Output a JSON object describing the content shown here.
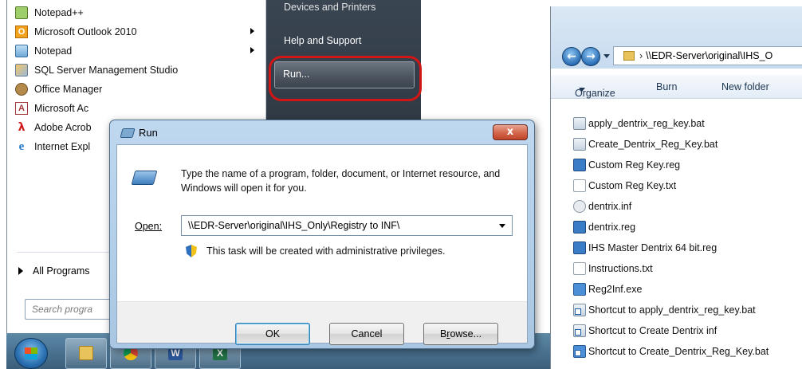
{
  "start_menu": {
    "programs": [
      {
        "label": "Notepad++",
        "icon": "notepad-plus-plus-icon",
        "has_submenu": false
      },
      {
        "label": "Microsoft Outlook 2010",
        "icon": "outlook-icon",
        "has_submenu": true
      },
      {
        "label": "Notepad",
        "icon": "notepad-icon",
        "has_submenu": true
      },
      {
        "label": "SQL Server Management Studio",
        "icon": "sql-server-icon",
        "has_submenu": false
      },
      {
        "label": "Office Manager",
        "icon": "office-manager-icon",
        "has_submenu": false
      },
      {
        "label": "Microsoft Ac",
        "icon": "access-icon",
        "has_submenu": false
      },
      {
        "label": "Adobe Acrob",
        "icon": "acrobat-icon",
        "has_submenu": false
      },
      {
        "label": "Internet Expl",
        "icon": "internet-explorer-icon",
        "has_submenu": false
      }
    ],
    "all_programs": "All Programs",
    "search_placeholder": "Search progra",
    "right_links": {
      "devices": "Devices and Printers",
      "help": "Help and Support",
      "run": "Run..."
    }
  },
  "run_dialog": {
    "title": "Run",
    "close_label": "x",
    "description": "Type the name of a program, folder, document, or Internet resource, and Windows will open it for you.",
    "open_label": "Open:",
    "open_value": "\\\\EDR-Server\\original\\IHS_Only\\Registry to INF\\",
    "admin_note": "This task will be created with administrative privileges.",
    "buttons": {
      "ok": "OK",
      "cancel": "Cancel",
      "browse_prefix": "B",
      "browse_accel": "r",
      "browse_suffix": "owse..."
    }
  },
  "explorer": {
    "address": "\\\\EDR-Server\\original\\IHS_O",
    "toolbar": {
      "organize": "Organize",
      "burn": "Burn",
      "new_folder": "New folder"
    },
    "files": [
      {
        "name": "apply_dentrix_reg_key.bat",
        "type": "bat"
      },
      {
        "name": "Create_Dentrix_Reg_Key.bat",
        "type": "bat"
      },
      {
        "name": "Custom Reg Key.reg",
        "type": "reg"
      },
      {
        "name": "Custom Reg Key.txt",
        "type": "txt"
      },
      {
        "name": "dentrix.inf",
        "type": "inf"
      },
      {
        "name": "dentrix.reg",
        "type": "reg"
      },
      {
        "name": "IHS Master Dentrix 64 bit.reg",
        "type": "reg"
      },
      {
        "name": "Instructions.txt",
        "type": "txt"
      },
      {
        "name": "Reg2Inf.exe",
        "type": "exe"
      },
      {
        "name": "Shortcut to apply_dentrix_reg_key.bat",
        "type": "lnk"
      },
      {
        "name": "Shortcut to Create Dentrix inf",
        "type": "lnk"
      },
      {
        "name": "Shortcut to Create_Dentrix_Reg_Key.bat",
        "type": "lnk"
      }
    ]
  },
  "taskbar": {
    "buttons": [
      {
        "name": "explorer-taskbar-button",
        "glyph": "",
        "color": "#e8c25a"
      },
      {
        "name": "chrome-taskbar-button",
        "glyph": "",
        "color": "#db4437"
      },
      {
        "name": "word-taskbar-button",
        "glyph": "W",
        "color": "#2b579a"
      },
      {
        "name": "excel-taskbar-button",
        "glyph": "X",
        "color": "#217346"
      }
    ]
  },
  "colors": {
    "highlight_ring": "#d21616",
    "start_menu_right": "#2f3944",
    "taskbar": "#4a7391"
  }
}
